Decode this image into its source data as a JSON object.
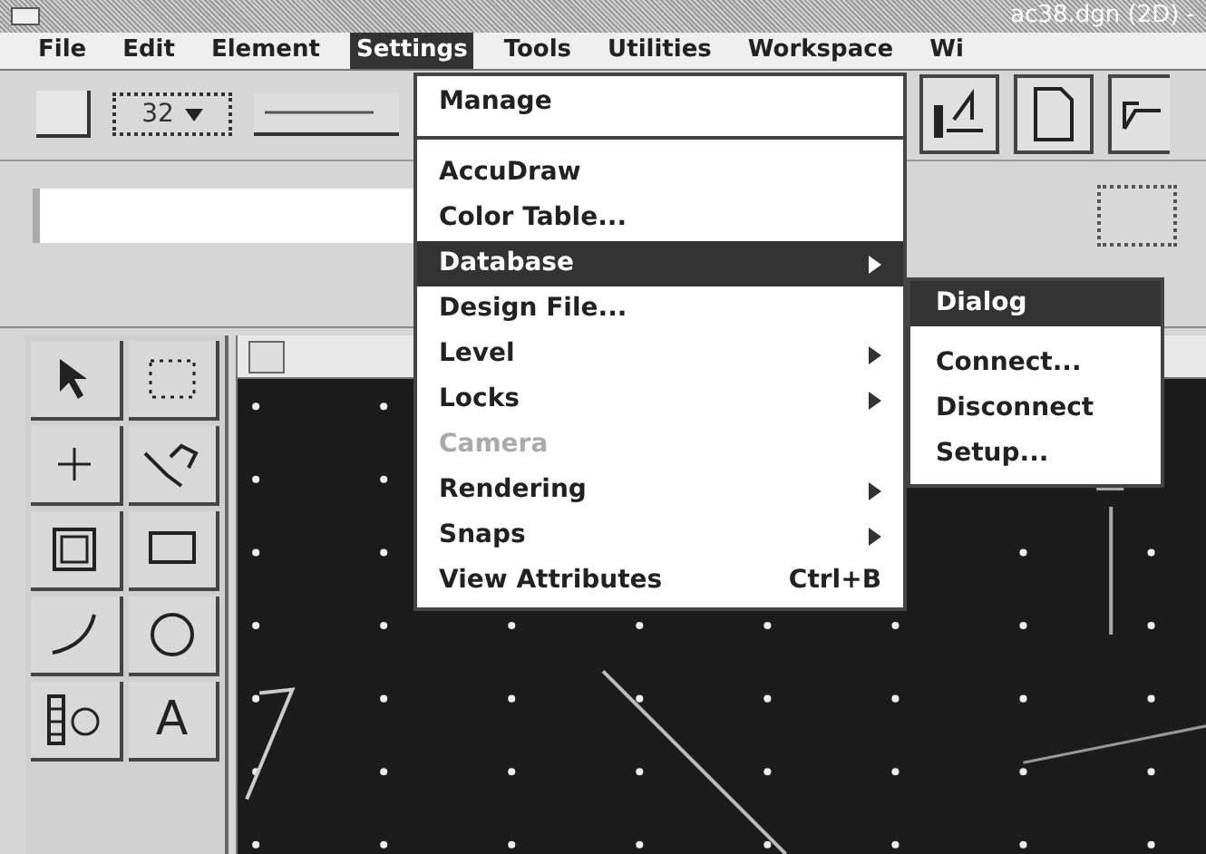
{
  "title_bar": {
    "title": "ac38.dgn (2D) -"
  },
  "menu_bar": [
    {
      "label": "File",
      "selected": false
    },
    {
      "label": "Edit",
      "selected": false
    },
    {
      "label": "Element",
      "selected": false
    },
    {
      "label": "Settings",
      "selected": true
    },
    {
      "label": "Tools",
      "selected": false
    },
    {
      "label": "Utilities",
      "selected": false
    },
    {
      "label": "Workspace",
      "selected": false
    },
    {
      "label": "Wi",
      "selected": false
    }
  ],
  "toolbar": {
    "weight_dropdown": "32"
  },
  "tool_palette": [
    {
      "kind": "arrow"
    },
    {
      "kind": "fence"
    },
    {
      "kind": "point"
    },
    {
      "kind": "polyline"
    },
    {
      "kind": "cell"
    },
    {
      "kind": "rectangle"
    },
    {
      "kind": "arc"
    },
    {
      "kind": "circle"
    },
    {
      "kind": "pattern"
    },
    {
      "kind": "text",
      "label": "A"
    }
  ],
  "settings_menu": [
    {
      "kind": "item",
      "label": "Manage",
      "selected": false,
      "disabled": false,
      "submenu": false
    },
    {
      "kind": "separator"
    },
    {
      "kind": "item",
      "label": "AccuDraw",
      "selected": false,
      "disabled": false,
      "submenu": false
    },
    {
      "kind": "item",
      "label": "Color Table...",
      "selected": false,
      "disabled": false,
      "submenu": false
    },
    {
      "kind": "item",
      "label": "Database",
      "selected": true,
      "disabled": false,
      "submenu": true
    },
    {
      "kind": "item",
      "label": "Design File...",
      "selected": false,
      "disabled": false,
      "submenu": false
    },
    {
      "kind": "item",
      "label": "Level",
      "selected": false,
      "disabled": false,
      "submenu": true
    },
    {
      "kind": "item",
      "label": "Locks",
      "selected": false,
      "disabled": false,
      "submenu": true
    },
    {
      "kind": "item",
      "label": "Camera",
      "selected": false,
      "disabled": true,
      "submenu": false
    },
    {
      "kind": "item",
      "label": "Rendering",
      "selected": false,
      "disabled": false,
      "submenu": true
    },
    {
      "kind": "item",
      "label": "Snaps",
      "selected": false,
      "disabled": false,
      "submenu": true
    },
    {
      "kind": "item",
      "label": "View Attributes",
      "shortcut": "Ctrl+B",
      "selected": false,
      "disabled": false,
      "submenu": false
    }
  ],
  "database_submenu": [
    {
      "label": "Dialog",
      "selected": true
    },
    {
      "label": "Connect...",
      "selected": false
    },
    {
      "label": "Disconnect",
      "selected": false
    },
    {
      "label": "Setup...",
      "selected": false
    }
  ]
}
